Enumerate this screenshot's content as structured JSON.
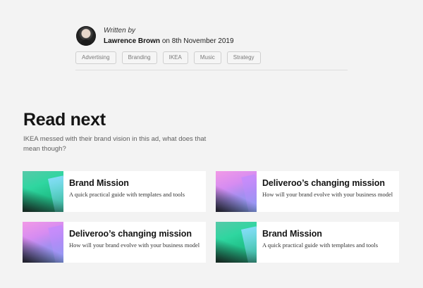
{
  "author": {
    "written_by": "Written by",
    "name": "Lawrence Brown",
    "date_text": "on 8th November 2019"
  },
  "tags": [
    "Advertising",
    "Branding",
    "IKEA",
    "Music",
    "Strategy"
  ],
  "read_next": {
    "title": "Read next",
    "subtitle": "IKEA messed with their brand vision in this ad, what does that mean though?",
    "cards": [
      {
        "title": "Brand Mission",
        "description": "A quick practical guide with templates and tools",
        "thumb": "teal-gradient"
      },
      {
        "title": "Deliveroo’s changing mission",
        "description": "How will your brand evolve with your business model",
        "thumb": "pink-gradient"
      },
      {
        "title": "Deliveroo’s changing mission",
        "description": "How will your brand evolve with your business model",
        "thumb": "pink-gradient"
      },
      {
        "title": "Brand Mission",
        "description": "A quick practical guide with templates and tools",
        "thumb": "teal-gradient"
      }
    ]
  },
  "colors": {
    "background": "#f3f3f3",
    "card": "#ffffff",
    "text": "#141414",
    "muted": "#606060"
  }
}
